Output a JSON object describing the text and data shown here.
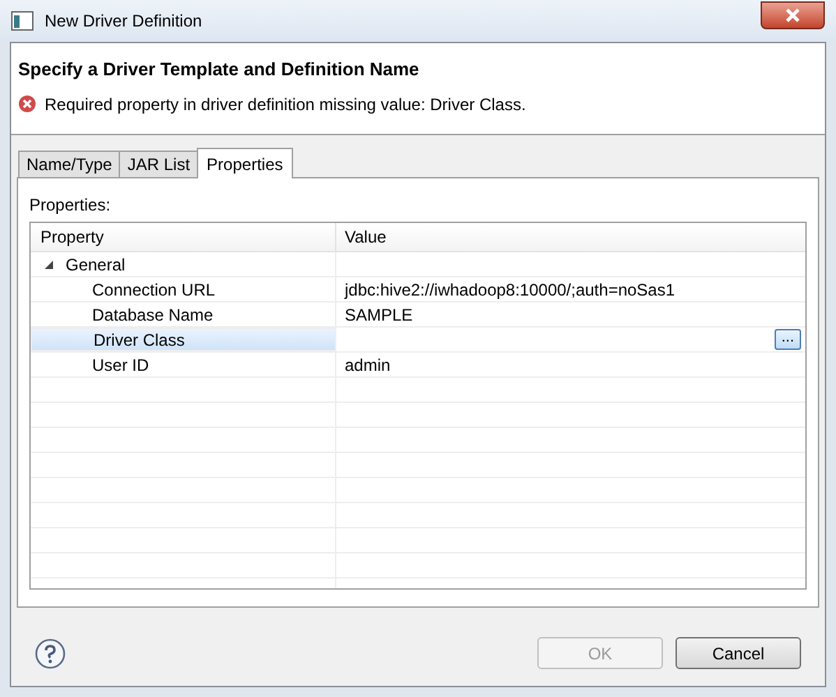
{
  "window": {
    "title": "New Driver Definition"
  },
  "header": {
    "title": "Specify a Driver Template and Definition Name",
    "message": "Required property in driver definition missing value: Driver Class."
  },
  "tabs": [
    {
      "label": "Name/Type",
      "selected": false
    },
    {
      "label": "JAR List",
      "selected": false
    },
    {
      "label": "Properties",
      "selected": true
    }
  ],
  "properties_label": "Properties:",
  "table": {
    "columns": [
      "Property",
      "Value"
    ],
    "rows": [
      {
        "property": "General",
        "expanded": true,
        "selected": false,
        "children": [
          {
            "property": "Connection URL",
            "value": "jdbc:hive2://iwhadoop8:10000/;auth=noSas1",
            "selected": false
          },
          {
            "property": "Database Name",
            "value": "SAMPLE",
            "selected": false
          },
          {
            "property": "Driver Class",
            "selected": true,
            "button": "..."
          },
          {
            "property": "User ID",
            "value": "admin",
            "selected": false
          }
        ]
      }
    ]
  },
  "buttons": [
    {
      "label": "OK",
      "disabled": true
    },
    {
      "label": "Cancel",
      "disabled": false
    }
  ]
}
